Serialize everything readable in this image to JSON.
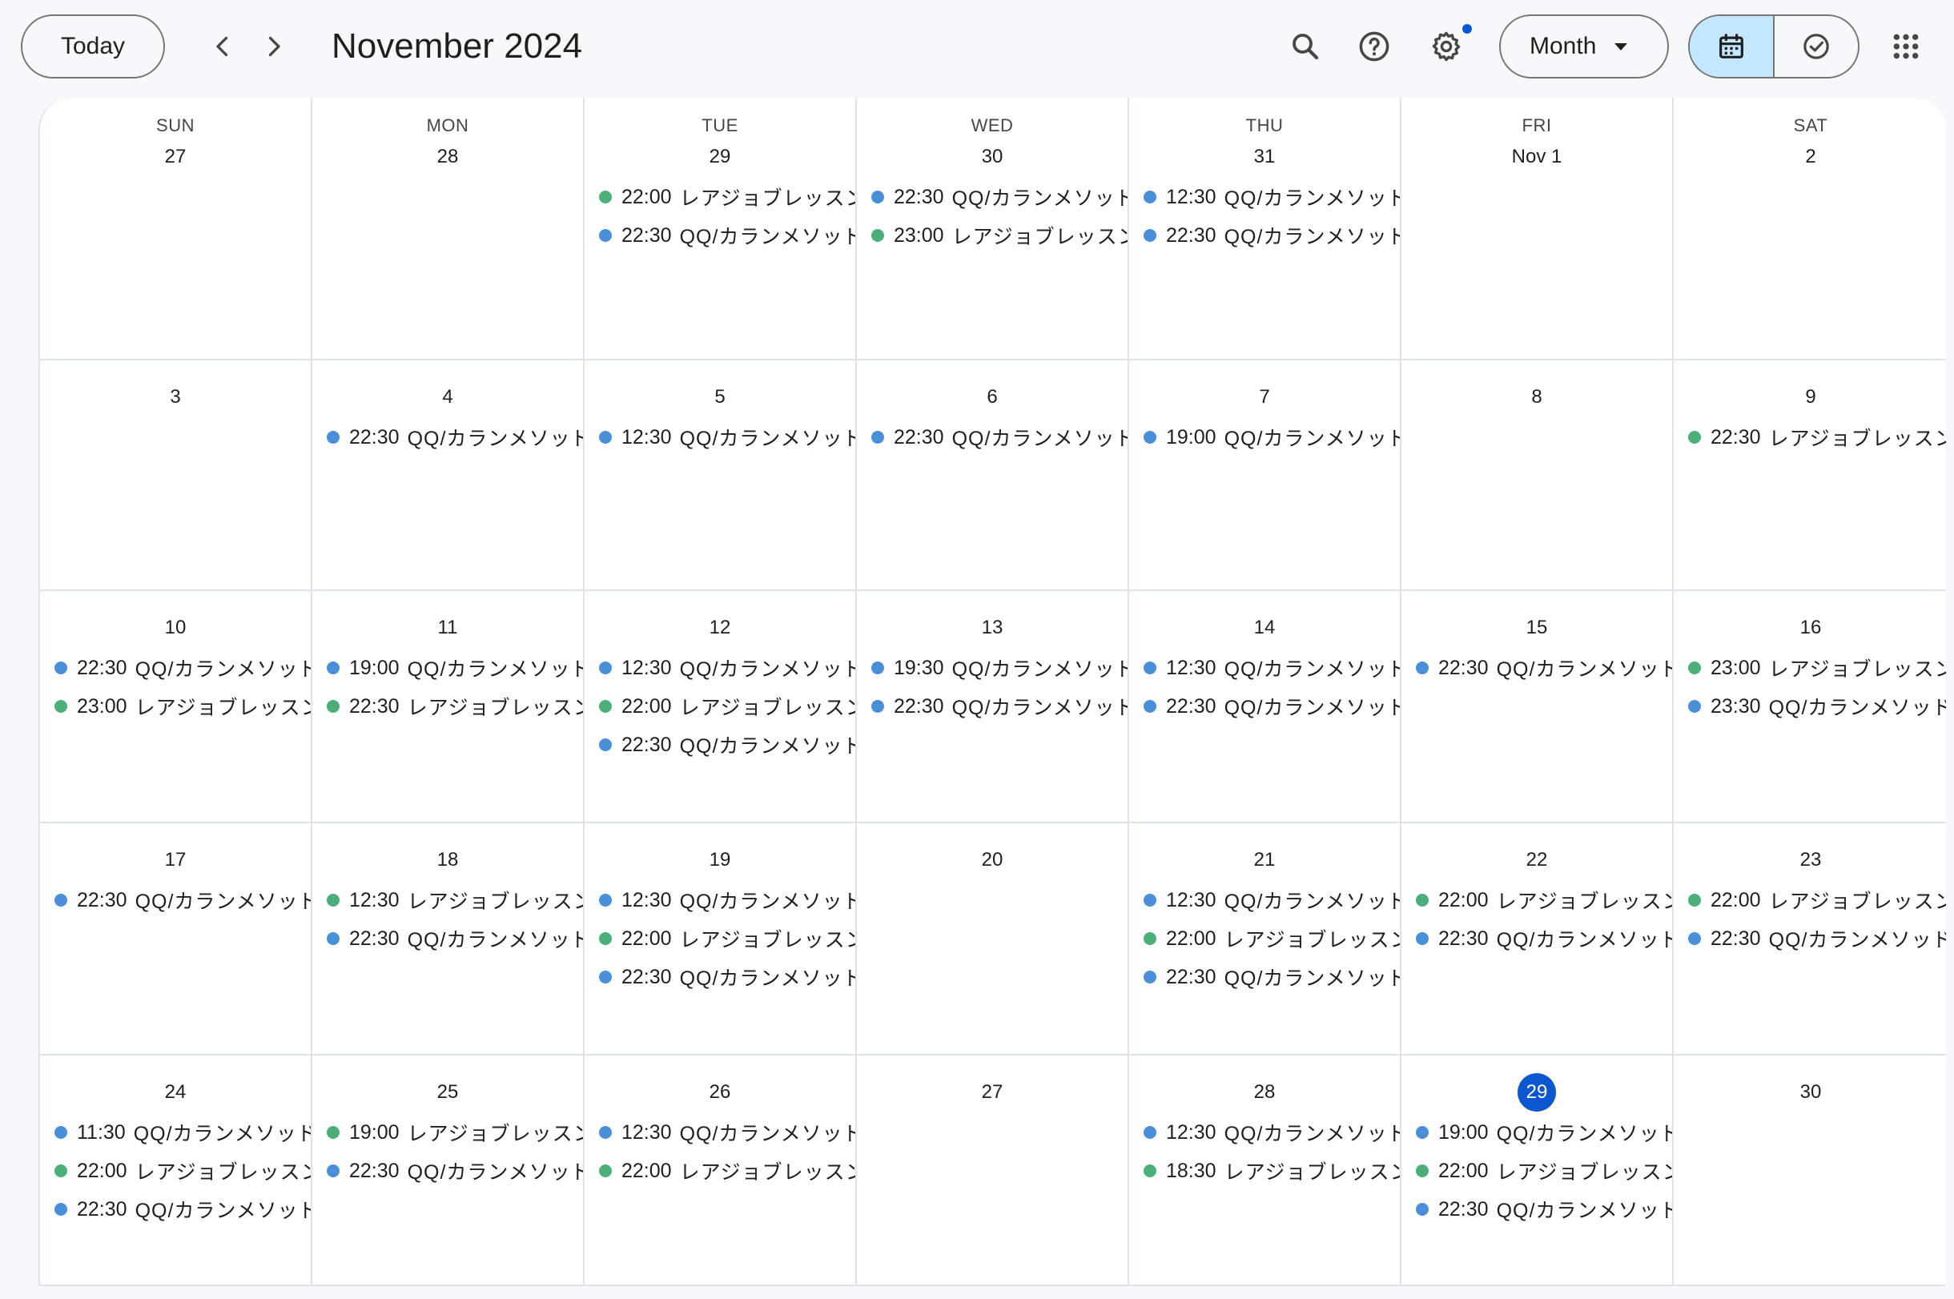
{
  "header": {
    "today_label": "Today",
    "title": "November 2024",
    "view_label": "Month"
  },
  "colors": {
    "blue": "#4a90d9",
    "green": "#4caf7a",
    "today": "#0b57d0",
    "toggle_active": "#c2e7ff"
  },
  "icons": {
    "prev": "chevron-left-icon",
    "next": "chevron-right-icon",
    "search": "search-icon",
    "help": "help-icon",
    "settings": "gear-icon",
    "calendar": "calendar-icon",
    "tasks": "task-check-icon",
    "apps": "apps-grid-icon",
    "caret": "caret-down-icon"
  },
  "weekdays": [
    "SUN",
    "MON",
    "TUE",
    "WED",
    "THU",
    "FRI",
    "SAT"
  ],
  "weeks": [
    {
      "days": [
        {
          "date": "27",
          "events": []
        },
        {
          "date": "28",
          "events": []
        },
        {
          "date": "29",
          "events": [
            {
              "time": "22:00",
              "title": "レアジョブレッスン",
              "color": "green"
            },
            {
              "time": "22:30",
              "title": "QQ/カランメソッド",
              "color": "blue"
            }
          ]
        },
        {
          "date": "30",
          "events": [
            {
              "time": "22:30",
              "title": "QQ/カランメソッド",
              "color": "blue"
            },
            {
              "time": "23:00",
              "title": "レアジョブレッスン",
              "color": "green"
            }
          ]
        },
        {
          "date": "31",
          "events": [
            {
              "time": "12:30",
              "title": "QQ/カランメソッド",
              "color": "blue"
            },
            {
              "time": "22:30",
              "title": "QQ/カランメソッド",
              "color": "blue"
            }
          ]
        },
        {
          "date": "Nov 1",
          "events": []
        },
        {
          "date": "2",
          "events": []
        }
      ]
    },
    {
      "days": [
        {
          "date": "3",
          "events": []
        },
        {
          "date": "4",
          "events": [
            {
              "time": "22:30",
              "title": "QQ/カランメソッド",
              "color": "blue"
            }
          ]
        },
        {
          "date": "5",
          "events": [
            {
              "time": "12:30",
              "title": "QQ/カランメソッド",
              "color": "blue"
            }
          ]
        },
        {
          "date": "6",
          "events": [
            {
              "time": "22:30",
              "title": "QQ/カランメソッド",
              "color": "blue"
            }
          ]
        },
        {
          "date": "7",
          "events": [
            {
              "time": "19:00",
              "title": "QQ/カランメソッド",
              "color": "blue"
            }
          ]
        },
        {
          "date": "8",
          "events": []
        },
        {
          "date": "9",
          "events": [
            {
              "time": "22:30",
              "title": "レアジョブレッスン",
              "color": "green"
            }
          ]
        }
      ]
    },
    {
      "days": [
        {
          "date": "10",
          "events": [
            {
              "time": "22:30",
              "title": "QQ/カランメソッド",
              "color": "blue"
            },
            {
              "time": "23:00",
              "title": "レアジョブレッスン",
              "color": "green"
            }
          ]
        },
        {
          "date": "11",
          "events": [
            {
              "time": "19:00",
              "title": "QQ/カランメソッド",
              "color": "blue"
            },
            {
              "time": "22:30",
              "title": "レアジョブレッスン",
              "color": "green"
            }
          ]
        },
        {
          "date": "12",
          "events": [
            {
              "time": "12:30",
              "title": "QQ/カランメソッド",
              "color": "blue"
            },
            {
              "time": "22:00",
              "title": "レアジョブレッスン",
              "color": "green"
            },
            {
              "time": "22:30",
              "title": "QQ/カランメソッド",
              "color": "blue"
            }
          ]
        },
        {
          "date": "13",
          "events": [
            {
              "time": "19:30",
              "title": "QQ/カランメソッド",
              "color": "blue"
            },
            {
              "time": "22:30",
              "title": "QQ/カランメソッド",
              "color": "blue"
            }
          ]
        },
        {
          "date": "14",
          "events": [
            {
              "time": "12:30",
              "title": "QQ/カランメソッド",
              "color": "blue"
            },
            {
              "time": "22:30",
              "title": "QQ/カランメソッド",
              "color": "blue"
            }
          ]
        },
        {
          "date": "15",
          "events": [
            {
              "time": "22:30",
              "title": "QQ/カランメソッド",
              "color": "blue"
            }
          ]
        },
        {
          "date": "16",
          "events": [
            {
              "time": "23:00",
              "title": "レアジョブレッスン",
              "color": "green"
            },
            {
              "time": "23:30",
              "title": "QQ/カランメソッド",
              "color": "blue"
            }
          ]
        }
      ]
    },
    {
      "days": [
        {
          "date": "17",
          "events": [
            {
              "time": "22:30",
              "title": "QQ/カランメソッド",
              "color": "blue"
            }
          ]
        },
        {
          "date": "18",
          "events": [
            {
              "time": "12:30",
              "title": "レアジョブレッスン",
              "color": "green"
            },
            {
              "time": "22:30",
              "title": "QQ/カランメソッド",
              "color": "blue"
            }
          ]
        },
        {
          "date": "19",
          "events": [
            {
              "time": "12:30",
              "title": "QQ/カランメソッド",
              "color": "blue"
            },
            {
              "time": "22:00",
              "title": "レアジョブレッスン",
              "color": "green"
            },
            {
              "time": "22:30",
              "title": "QQ/カランメソッド",
              "color": "blue"
            }
          ]
        },
        {
          "date": "20",
          "events": []
        },
        {
          "date": "21",
          "events": [
            {
              "time": "12:30",
              "title": "QQ/カランメソッド",
              "color": "blue"
            },
            {
              "time": "22:00",
              "title": "レアジョブレッスン",
              "color": "green"
            },
            {
              "time": "22:30",
              "title": "QQ/カランメソッド",
              "color": "blue"
            }
          ]
        },
        {
          "date": "22",
          "events": [
            {
              "time": "22:00",
              "title": "レアジョブレッスン",
              "color": "green"
            },
            {
              "time": "22:30",
              "title": "QQ/カランメソッド",
              "color": "blue"
            }
          ]
        },
        {
          "date": "23",
          "events": [
            {
              "time": "22:00",
              "title": "レアジョブレッスン",
              "color": "green"
            },
            {
              "time": "22:30",
              "title": "QQ/カランメソッド",
              "color": "blue"
            }
          ]
        }
      ]
    },
    {
      "days": [
        {
          "date": "24",
          "events": [
            {
              "time": "11:30",
              "title": "QQ/カランメソッド",
              "color": "blue"
            },
            {
              "time": "22:00",
              "title": "レアジョブレッスン",
              "color": "green"
            },
            {
              "time": "22:30",
              "title": "QQ/カランメソッド",
              "color": "blue"
            }
          ]
        },
        {
          "date": "25",
          "events": [
            {
              "time": "19:00",
              "title": "レアジョブレッスン",
              "color": "green"
            },
            {
              "time": "22:30",
              "title": "QQ/カランメソッド",
              "color": "blue"
            }
          ]
        },
        {
          "date": "26",
          "events": [
            {
              "time": "12:30",
              "title": "QQ/カランメソッド",
              "color": "blue"
            },
            {
              "time": "22:00",
              "title": "レアジョブレッスン",
              "color": "green"
            }
          ]
        },
        {
          "date": "27",
          "events": []
        },
        {
          "date": "28",
          "events": [
            {
              "time": "12:30",
              "title": "QQ/カランメソッド",
              "color": "blue"
            },
            {
              "time": "18:30",
              "title": "レアジョブレッスン",
              "color": "green"
            }
          ]
        },
        {
          "date": "29",
          "today": true,
          "events": [
            {
              "time": "19:00",
              "title": "QQ/カランメソッド",
              "color": "blue"
            },
            {
              "time": "22:00",
              "title": "レアジョブレッスン",
              "color": "green"
            },
            {
              "time": "22:30",
              "title": "QQ/カランメソッド",
              "color": "blue"
            }
          ]
        },
        {
          "date": "30",
          "events": []
        }
      ]
    }
  ]
}
